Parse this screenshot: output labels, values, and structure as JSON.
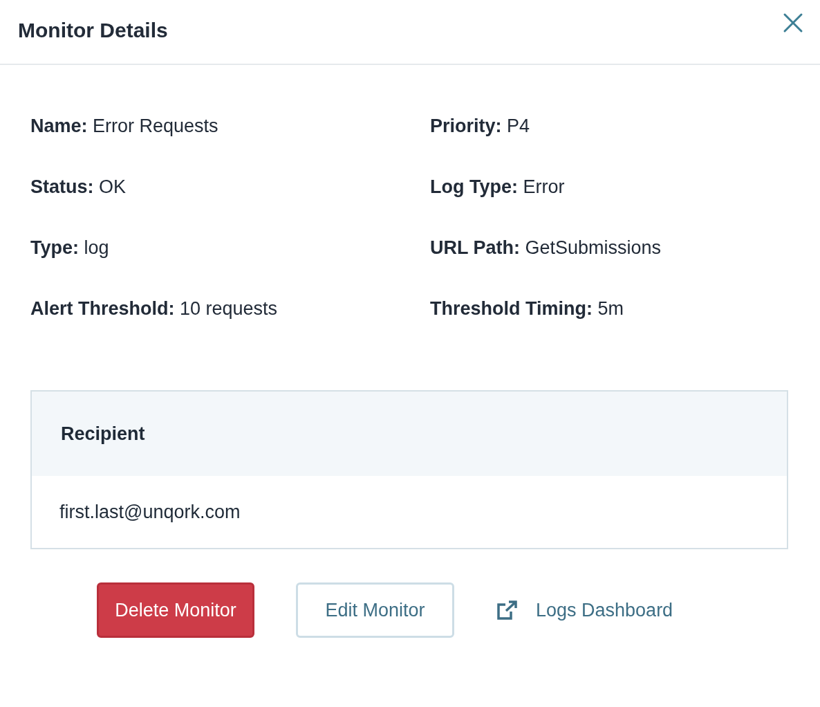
{
  "dialog": {
    "title": "Monitor Details"
  },
  "fields": [
    {
      "text": "**Name:** Error Requests"
    },
    {
      "text": "**Priority:** P4"
    },
    {
      "text": "**Status:** OK"
    },
    {
      "text": "**Log Type:** Error"
    },
    {
      "text": "**Type:** log"
    },
    {
      "text": "**URL Path:** GetSubmissions"
    },
    {
      "text": "**Alert Threshold:** 10 requests"
    },
    {
      "text": "**Threshold Timing:** 5m"
    }
  ],
  "table": {
    "columns": [
      "Recipient"
    ],
    "rows": [
      [
        "first.last@unqork.com"
      ]
    ]
  },
  "buttons": [
    {
      "label": "Delete Monitor",
      "kind": "danger"
    },
    {
      "label": "Edit Monitor",
      "kind": "outline"
    },
    {
      "label": "Logs Dashboard",
      "kind": "link"
    }
  ]
}
